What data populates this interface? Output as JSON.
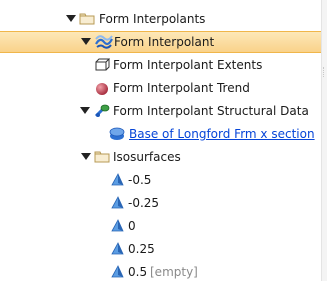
{
  "tree": {
    "form_interpolants": {
      "label": "Form Interpolants",
      "icon": "folder-icon",
      "expanded": true
    },
    "form_interpolant": {
      "label": "Form Interpolant",
      "icon": "form-interpolant-icon",
      "expanded": true,
      "selected": true
    },
    "extents": {
      "label": "Form Interpolant Extents",
      "icon": "extents-icon"
    },
    "trend": {
      "label": "Form Interpolant Trend",
      "icon": "trend-icon"
    },
    "structural_data": {
      "label": "Form Interpolant Structural Data",
      "icon": "structural-data-icon",
      "expanded": true
    },
    "base_longford": {
      "label": "Base of Longford Frm x section",
      "icon": "surface-link-icon"
    },
    "isosurfaces": {
      "label": "Isosurfaces",
      "icon": "folder-icon",
      "expanded": true
    },
    "iso_items": [
      {
        "label": "-0.5",
        "icon": "isosurface-triangle-icon"
      },
      {
        "label": "-0.25",
        "icon": "isosurface-triangle-icon"
      },
      {
        "label": "0",
        "icon": "isosurface-triangle-icon"
      },
      {
        "label": "0.25",
        "icon": "isosurface-triangle-icon"
      },
      {
        "label": "0.5",
        "icon": "isosurface-triangle-icon",
        "note": "[empty]"
      }
    ]
  },
  "colors": {
    "selection_top": "#fde8b8",
    "selection_bottom": "#f9d28a",
    "link": "#0645d8",
    "muted": "#8a8a8a"
  }
}
